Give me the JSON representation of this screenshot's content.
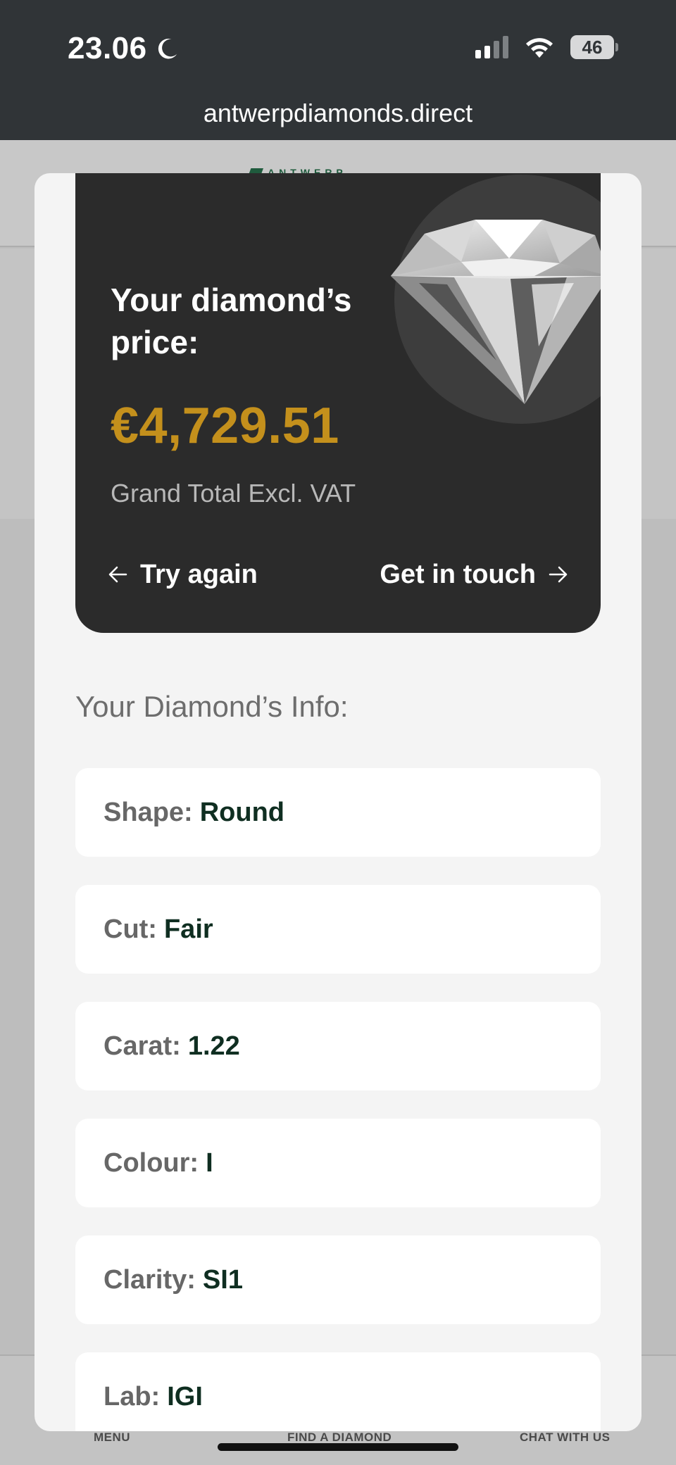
{
  "status_bar": {
    "time": "23.06",
    "battery": "46"
  },
  "browser": {
    "url": "antwerpdiamonds.direct"
  },
  "background_page": {
    "logo_text": "ANTWERP",
    "bottom_nav": [
      "MENU",
      "FIND A DIAMOND",
      "CHAT WITH US"
    ]
  },
  "price_card": {
    "heading": "Your diamond’s price:",
    "price": "€4,729.51",
    "note": "Grand Total Excl. VAT",
    "try_again": "Try again",
    "get_in_touch": "Get in touch",
    "price_color": "#c4901c"
  },
  "info": {
    "heading": "Your Diamond’s Info:",
    "rows": [
      {
        "label": "Shape:",
        "value": "Round"
      },
      {
        "label": "Cut:",
        "value": "Fair"
      },
      {
        "label": "Carat:",
        "value": "1.22"
      },
      {
        "label": "Colour:",
        "value": "I"
      },
      {
        "label": "Clarity:",
        "value": "SI1"
      },
      {
        "label": "Lab:",
        "value": "IGI"
      }
    ]
  },
  "icons": {
    "status": [
      "moon-icon",
      "cellular-signal-icon",
      "wifi-icon",
      "battery-icon"
    ],
    "card": [
      "arrow-left-icon",
      "arrow-right-icon",
      "diamond-image"
    ]
  }
}
